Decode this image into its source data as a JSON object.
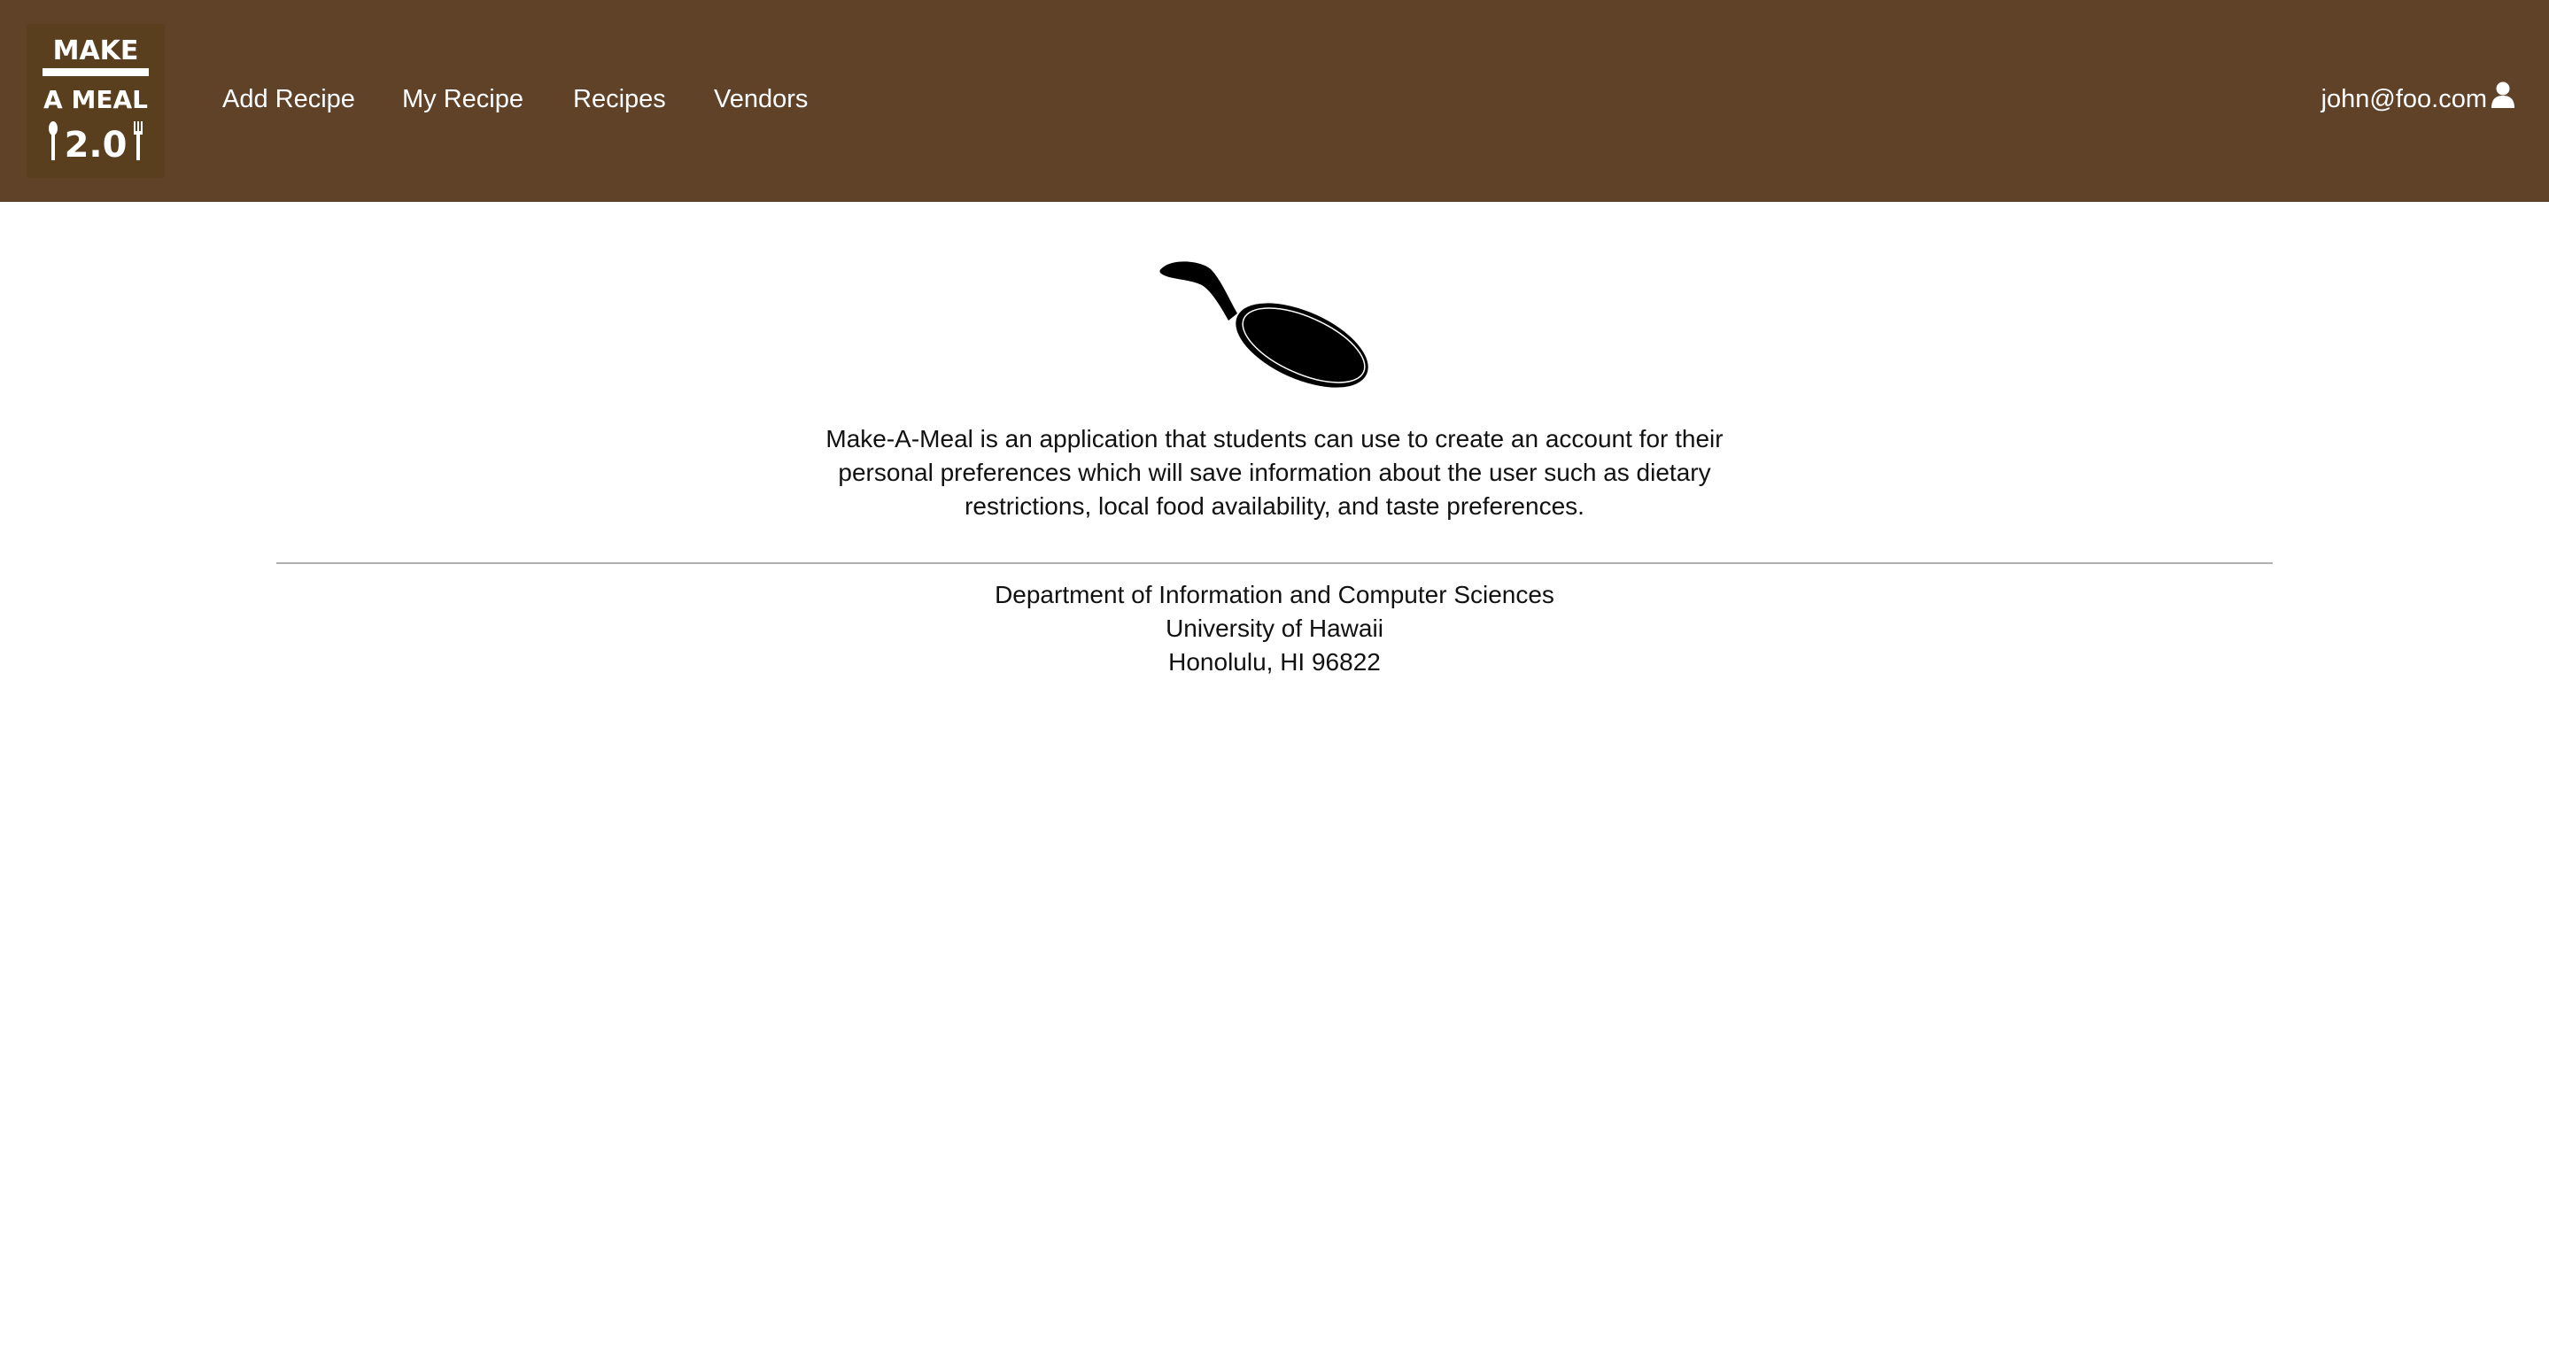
{
  "navbar": {
    "logo": {
      "text_line1": "MAKE",
      "text_line2": "A MEAL",
      "text_line3": "2.0"
    },
    "links": [
      {
        "label": "Add Recipe"
      },
      {
        "label": "My Recipe"
      },
      {
        "label": "Recipes"
      },
      {
        "label": "Vendors"
      }
    ],
    "user": {
      "email": "john@foo.com",
      "icon": "user-icon"
    }
  },
  "main": {
    "illustration": "frying-pan-icon",
    "description": "Make-A-Meal is an application that students can use to create an account for their personal preferences which will save information about the user such as dietary restrictions, local food availability, and taste preferences."
  },
  "footer": {
    "line1": "Department of Information and Computer Sciences",
    "line2": "University of Hawaii",
    "line3": "Honolulu, HI 96822"
  },
  "colors": {
    "navbar_bg": "#5f4228",
    "logo_bg": "#5a3f1f",
    "text": "#111111",
    "nav_text": "#ffffff"
  }
}
